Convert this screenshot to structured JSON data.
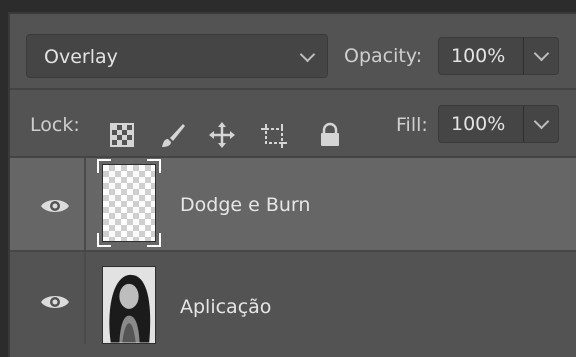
{
  "blend_mode": {
    "value": "Overlay"
  },
  "opacity": {
    "label": "Opacity:",
    "value": "100%"
  },
  "lock": {
    "label": "Lock:",
    "icons": [
      "lock-transparent-pixels-icon",
      "lock-image-pixels-icon",
      "lock-position-icon",
      "lock-artboard-icon",
      "lock-all-icon"
    ]
  },
  "fill": {
    "label": "Fill:",
    "value": "100%"
  },
  "layers": [
    {
      "name": "Dodge e Burn",
      "selected": true,
      "visible": true,
      "thumbnail": "transparent-checker"
    },
    {
      "name": "Aplicação",
      "selected": false,
      "visible": true,
      "thumbnail": "portrait-photo"
    }
  ],
  "colors": {
    "panel": "#535353",
    "selected_row": "#666666",
    "field": "#454545",
    "text": "#e3e3e3"
  }
}
